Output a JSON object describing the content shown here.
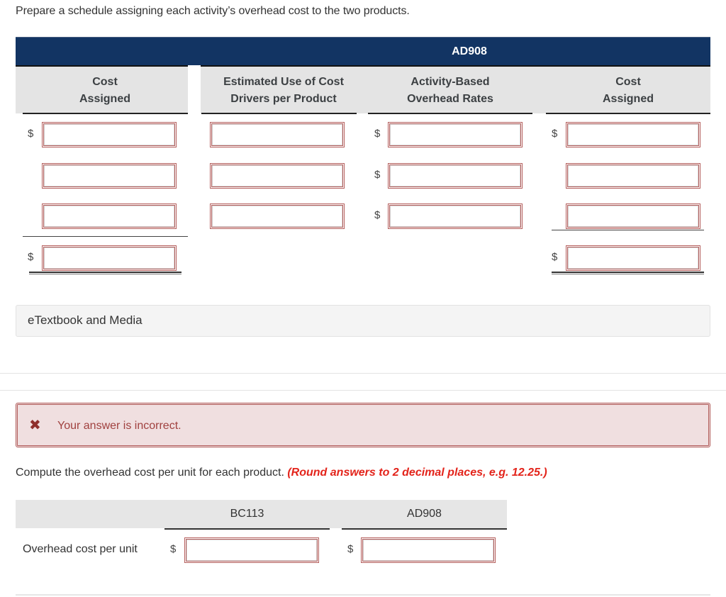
{
  "instruction": "Prepare a schedule assigning each activity’s overhead cost to the two products.",
  "schedule": {
    "product_header": "AD908",
    "columns": [
      {
        "line1": "Cost",
        "line2": "Assigned"
      },
      {
        "line1": "Estimated Use of Cost",
        "line2": "Drivers per Product"
      },
      {
        "line1": "Activity-Based",
        "line2": "Overhead Rates"
      },
      {
        "line1": "Cost",
        "line2": "Assigned"
      }
    ],
    "currency_symbol": "$",
    "rows": [
      {
        "col1": "",
        "col2": "",
        "col3": "",
        "col4": ""
      },
      {
        "col1": "",
        "col2": "",
        "col3": "",
        "col4": ""
      },
      {
        "col1": "",
        "col2": "",
        "col3": "",
        "col4": ""
      }
    ],
    "totals": {
      "col1": "",
      "col4": ""
    }
  },
  "etextbook": {
    "label": "eTextbook and Media"
  },
  "feedback": {
    "icon": "✖",
    "message": "Your answer is incorrect."
  },
  "compute": {
    "text": "Compute the overhead cost per unit for each product. ",
    "note": "(Round answers to 2 decimal places, e.g. 12.25.)"
  },
  "per_unit": {
    "columns": [
      "BC113",
      "AD908"
    ],
    "row_label": "Overhead cost per unit",
    "currency_symbol": "$",
    "values": [
      "",
      ""
    ]
  },
  "colors": {
    "header_band": "#123463",
    "input_border_incorrect": "#b45e5c",
    "incorrect_bg": "#f0dfe0",
    "note_red": "#e3241b"
  }
}
